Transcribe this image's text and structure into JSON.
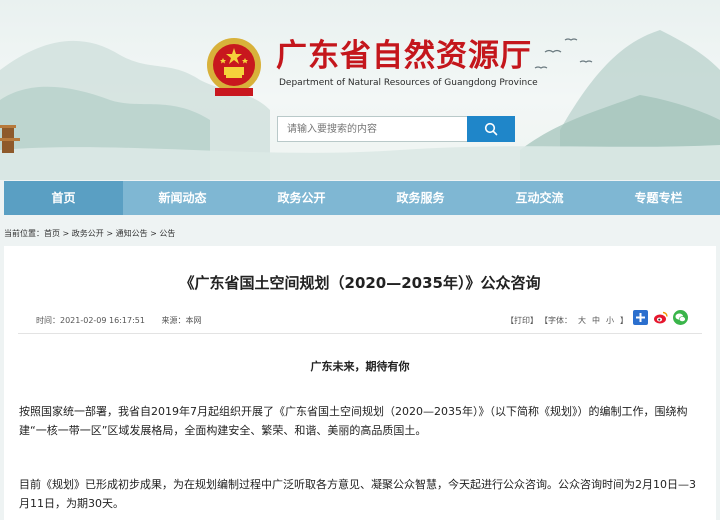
{
  "header": {
    "title": "广东省自然资源厅",
    "subtitle": "Department of Natural Resources of Guangdong Province",
    "emblem_icon": "national-emblem-icon",
    "search": {
      "placeholder": "请输入要搜索的内容",
      "button_icon": "search-icon"
    }
  },
  "nav": {
    "items": [
      {
        "label": "首页",
        "active": true
      },
      {
        "label": "新闻动态"
      },
      {
        "label": "政务公开"
      },
      {
        "label": "政务服务"
      },
      {
        "label": "互动交流"
      },
      {
        "label": "专题专栏"
      }
    ]
  },
  "breadcrumb": {
    "prefix": "当前位置：",
    "items": [
      "首页",
      "政务公开",
      "通知公告",
      "公告"
    ],
    "separator": " > "
  },
  "article": {
    "title": "《广东省国土空间规划（2020—2035年）》公众咨询",
    "time": "时间：2021-02-09 16:17:51",
    "source": "来源：本网",
    "print": "【打印】",
    "font_size_label": "【字体：",
    "font_sizes": [
      "大",
      "中",
      "小"
    ],
    "font_size_end": "】",
    "share_icons": [
      "share-plus-icon",
      "weibo-icon",
      "wechat-icon"
    ],
    "subheading": "广东未来，期待有你",
    "paragraphs": [
      "按照国家统一部署，我省自2019年7月起组织开展了《广东省国土空间规划（2020—2035年）》（以下简称《规划》）的编制工作，围绕构建“一核一带一区”区域发展格局，全面构建安全、繁荣、和谐、美丽的高品质国土。",
      "目前《规划》已形成初步成果，为在规划编制过程中广泛听取各方意见、凝聚公众智慧，今天起进行公众咨询。公众咨询时间为2月10日—3月11日，为期30天。"
    ]
  },
  "colors": {
    "title_red": "#c4161c",
    "nav_bg": "#7fb7d3",
    "nav_active": "#5a9fc3",
    "search_button": "#1f86c9"
  }
}
